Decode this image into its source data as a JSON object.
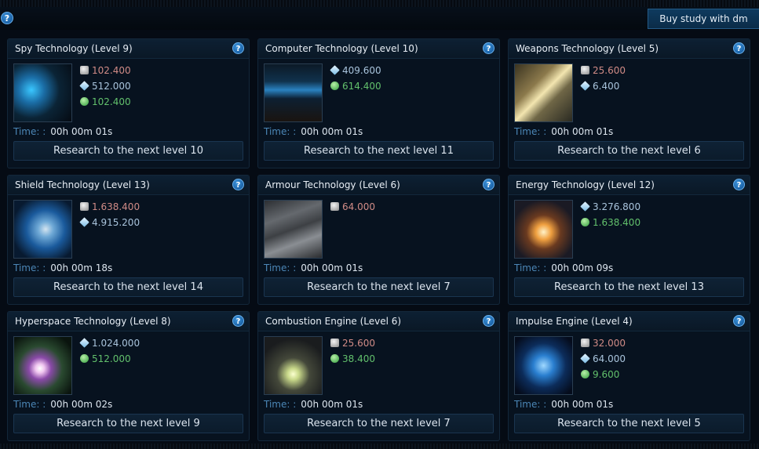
{
  "header": {
    "help_symbol": "?",
    "buy_button_label": "Buy study with dm"
  },
  "colors": {
    "metal": "#d08b86",
    "crystal": "#a9c4dc",
    "deuterium": "#62c06c",
    "time_label": "#4b86b6",
    "accent": "#0e3a5e"
  },
  "time_label": "Time: :",
  "cards": [
    {
      "title": "Spy Technology (Level 9)",
      "icon": "spy-technology-image",
      "metal": "102.400",
      "crystal": "512.000",
      "deuterium": "102.400",
      "time": "00h 00m 01s",
      "button": "Research to the next level 10"
    },
    {
      "title": "Computer Technology (Level 10)",
      "icon": "computer-technology-image",
      "crystal": "409.600",
      "deuterium": "614.400",
      "time": "00h 00m 01s",
      "button": "Research to the next level 11"
    },
    {
      "title": "Weapons Technology (Level 5)",
      "icon": "weapons-technology-image",
      "metal": "25.600",
      "crystal": "6.400",
      "time": "00h 00m 01s",
      "button": "Research to the next level 6"
    },
    {
      "title": "Shield Technology (Level 13)",
      "icon": "shield-technology-image",
      "metal": "1.638.400",
      "crystal": "4.915.200",
      "time": "00h 00m 18s",
      "button": "Research to the next level 14"
    },
    {
      "title": "Armour Technology (Level 6)",
      "icon": "armour-technology-image",
      "metal": "64.000",
      "time": "00h 00m 01s",
      "button": "Research to the next level 7"
    },
    {
      "title": "Energy Technology (Level 12)",
      "icon": "energy-technology-image",
      "crystal": "3.276.800",
      "deuterium": "1.638.400",
      "time": "00h 00m 09s",
      "button": "Research to the next level 13"
    },
    {
      "title": "Hyperspace Technology (Level 8)",
      "icon": "hyperspace-technology-image",
      "crystal": "1.024.000",
      "deuterium": "512.000",
      "time": "00h 00m 02s",
      "button": "Research to the next level 9"
    },
    {
      "title": "Combustion Engine (Level 6)",
      "icon": "combustion-engine-image",
      "metal": "25.600",
      "deuterium": "38.400",
      "time": "00h 00m 01s",
      "button": "Research to the next level 7"
    },
    {
      "title": "Impulse Engine (Level 4)",
      "icon": "impulse-engine-image",
      "metal": "32.000",
      "crystal": "64.000",
      "deuterium": "9.600",
      "time": "00h 00m 01s",
      "button": "Research to the next level 5"
    }
  ]
}
